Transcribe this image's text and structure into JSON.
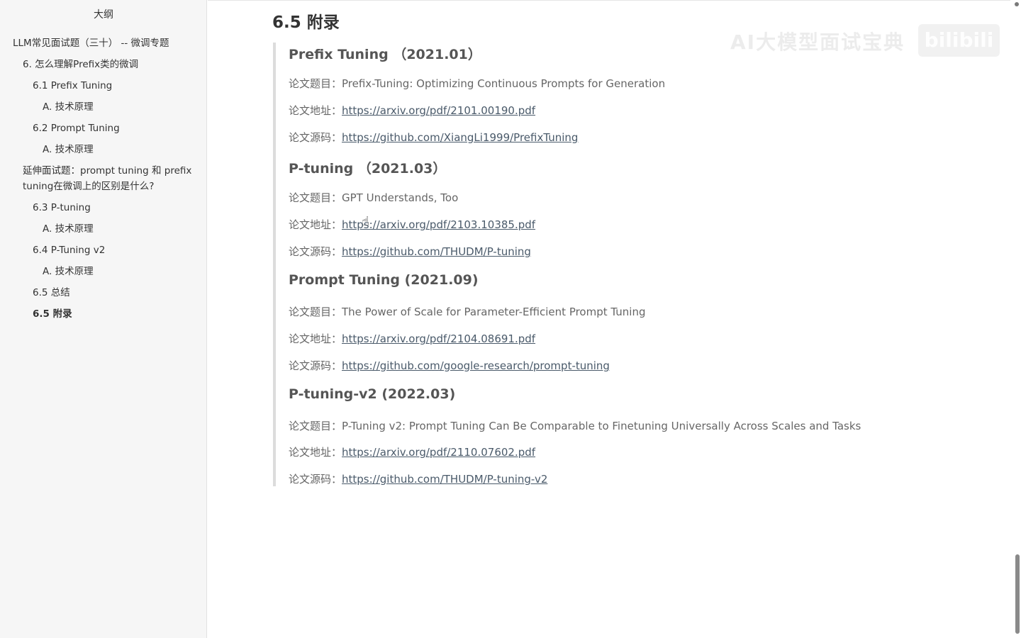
{
  "sidebar": {
    "title": "大纲",
    "items": [
      {
        "label": "LLM常见面试题（三十） -- 微调专题",
        "level": 1
      },
      {
        "label": "6. 怎么理解Prefix类的微调",
        "level": 2
      },
      {
        "label": "6.1 Prefix Tuning",
        "level": 3
      },
      {
        "label": "A. 技术原理",
        "level": 4
      },
      {
        "label": "6.2 Prompt Tuning",
        "level": 3
      },
      {
        "label": "A. 技术原理",
        "level": 4
      },
      {
        "label": "延伸面试题：prompt tuning 和 prefix tuning在微调上的区别是什么?",
        "level": 2
      },
      {
        "label": "6.3 P-tuning",
        "level": 3
      },
      {
        "label": "A. 技术原理",
        "level": 4
      },
      {
        "label": "6.4 P-Tuning v2",
        "level": 3
      },
      {
        "label": "A. 技术原理",
        "level": 4
      },
      {
        "label": "6.5 总结",
        "level": 3
      },
      {
        "label": "6.5 附录",
        "level": 3,
        "active": true
      }
    ]
  },
  "main": {
    "section_title": "6.5 附录",
    "papers": [
      {
        "heading": "Prefix Tuning （2021.01）",
        "title_label": "论文题目：",
        "title": "Prefix-Tuning: Optimizing Continuous Prompts for Generation",
        "url_label": "论文地址：",
        "url": "https://arxiv.org/pdf/2101.00190.pdf",
        "code_label": "论文源码：",
        "code": "https://github.com/XiangLi1999/PrefixTuning"
      },
      {
        "heading": "P-tuning （2021.03）",
        "title_label": "论文题目：",
        "title": "GPT Understands, Too",
        "url_label": "论文地址：",
        "url": "https://arxiv.org/pdf/2103.10385.pdf",
        "code_label": "论文源码：",
        "code": "https://github.com/THUDM/P-tuning"
      },
      {
        "heading": "Prompt Tuning (2021.09)",
        "title_label": "论文题目：",
        "title": "The Power of Scale for Parameter-Efficient Prompt Tuning",
        "url_label": "论文地址：",
        "url": "https://arxiv.org/pdf/2104.08691.pdf",
        "code_label": "论文源码：",
        "code": "https://github.com/google-research/prompt-tuning"
      },
      {
        "heading": "P-tuning-v2 (2022.03)",
        "title_label": "论文题目：",
        "title": "P-Tuning v2: Prompt Tuning Can Be Comparable to Finetuning Universally Across Scales and Tasks",
        "url_label": "论文地址：",
        "url": "https://arxiv.org/pdf/2110.07602.pdf",
        "code_label": "论文源码：",
        "code": "https://github.com/THUDM/P-tuning-v2"
      }
    ]
  },
  "watermark": {
    "text": "AI大模型面试宝典",
    "logo": "bilibili"
  }
}
